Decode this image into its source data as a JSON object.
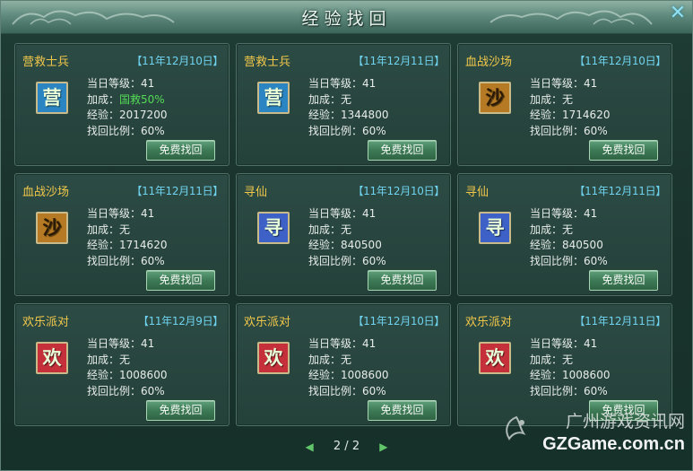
{
  "window": {
    "title": "经验找回"
  },
  "close_glyph": "✕",
  "button_label": "免费找回",
  "labels": {
    "level": "当日等级：",
    "bonus": "加成：",
    "exp": "经验：",
    "ratio": "找回比例："
  },
  "cards": [
    {
      "name": "营救士兵",
      "date": "【11年12月10日】",
      "icon_char": "营",
      "icon_color": "#2b85c2",
      "level": "41",
      "bonus": "国救50%",
      "exp": "2017200",
      "ratio": "60%"
    },
    {
      "name": "营救士兵",
      "date": "【11年12月11日】",
      "icon_char": "营",
      "icon_color": "#2b85c2",
      "level": "41",
      "bonus": "无",
      "exp": "1344800",
      "ratio": "60%"
    },
    {
      "name": "血战沙场",
      "date": "【11年12月10日】",
      "icon_char": "沙",
      "icon_color": "#b57a23",
      "level": "41",
      "bonus": "无",
      "exp": "1714620",
      "ratio": "60%"
    },
    {
      "name": "血战沙场",
      "date": "【11年12月11日】",
      "icon_char": "沙",
      "icon_color": "#b57a23",
      "level": "41",
      "bonus": "无",
      "exp": "1714620",
      "ratio": "60%"
    },
    {
      "name": "寻仙",
      "date": "【11年12月10日】",
      "icon_char": "寻",
      "icon_color": "#3d61c6",
      "level": "41",
      "bonus": "无",
      "exp": "840500",
      "ratio": "60%"
    },
    {
      "name": "寻仙",
      "date": "【11年12月11日】",
      "icon_char": "寻",
      "icon_color": "#3d61c6",
      "level": "41",
      "bonus": "无",
      "exp": "840500",
      "ratio": "60%"
    },
    {
      "name": "欢乐派对",
      "date": "【11年12月9日】",
      "icon_char": "欢",
      "icon_color": "#c5303a",
      "level": "41",
      "bonus": "无",
      "exp": "1008600",
      "ratio": "60%"
    },
    {
      "name": "欢乐派对",
      "date": "【11年12月10日】",
      "icon_char": "欢",
      "icon_color": "#c5303a",
      "level": "41",
      "bonus": "无",
      "exp": "1008600",
      "ratio": "60%"
    },
    {
      "name": "欢乐派对",
      "date": "【11年12月11日】",
      "icon_char": "欢",
      "icon_color": "#c5303a",
      "level": "41",
      "bonus": "无",
      "exp": "1008600",
      "ratio": "60%"
    }
  ],
  "pager": {
    "prev": "◀",
    "text": "2 / 2",
    "next": "▶"
  },
  "watermark": {
    "cn": "广州游戏资讯网",
    "url": "GZGame.com.cn"
  }
}
